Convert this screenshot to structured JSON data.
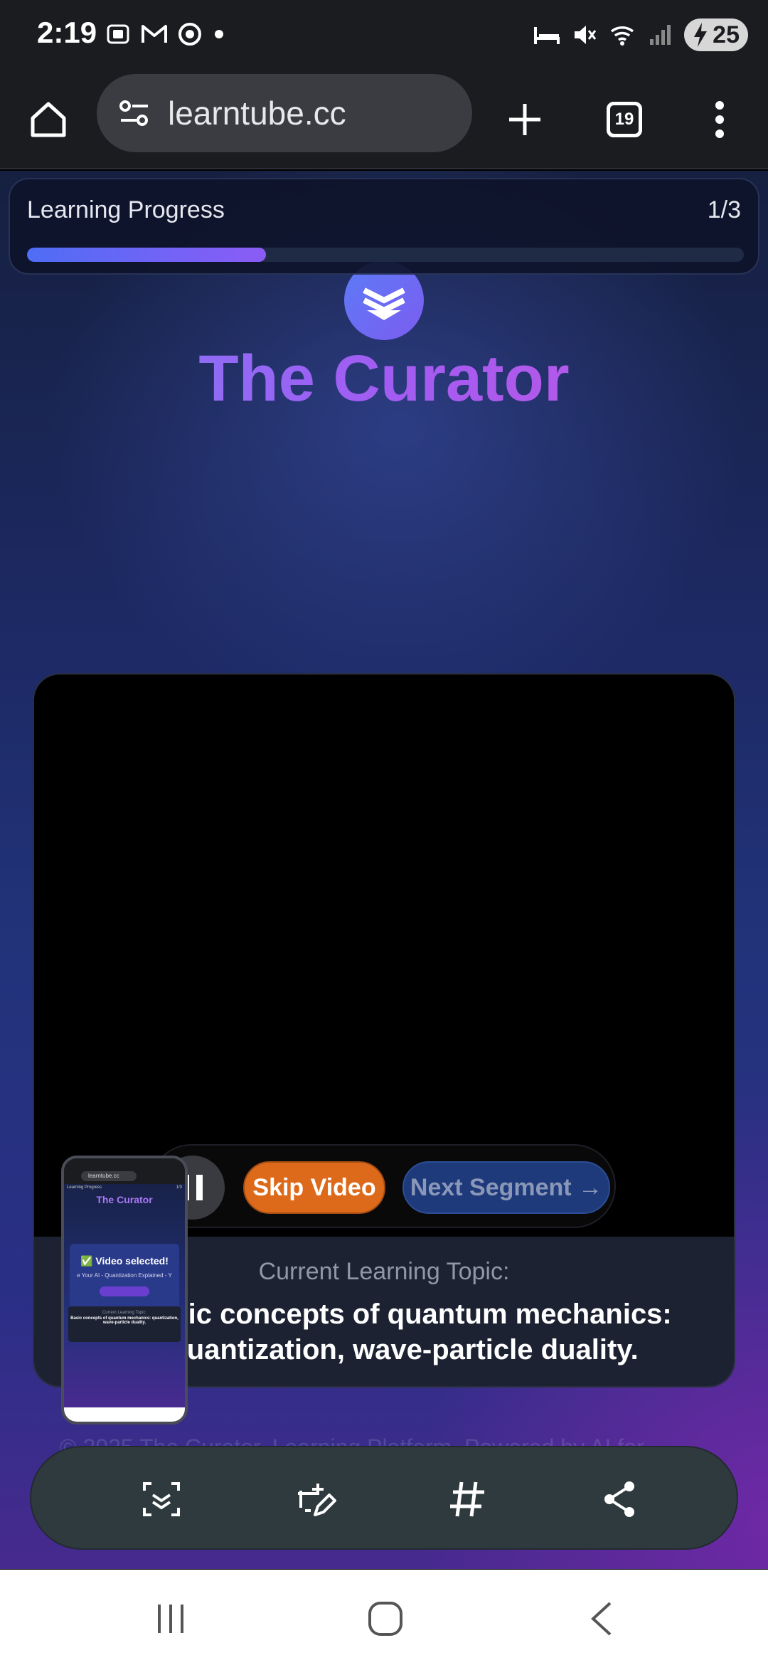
{
  "status_bar": {
    "time": "2:19",
    "battery": "25",
    "icons": [
      "screenshot-icon",
      "gmail-icon",
      "chrome-icon",
      "dot-icon",
      "sleep-icon",
      "mute-icon",
      "wifi-icon",
      "signal-icon",
      "battery-icon"
    ]
  },
  "browser": {
    "url": "learntube.cc",
    "tab_count": "19"
  },
  "progress": {
    "title": "Learning Progress",
    "count": "1/3",
    "fraction": 0.333
  },
  "brand": {
    "name": "The Curator"
  },
  "video": {
    "skip_label": "Skip Video",
    "next_label": "Next Segment →"
  },
  "topic": {
    "label": "Current Learning Topic:",
    "text": "Basic concepts of quantum mechanics: quantization, wave-particle duality."
  },
  "footer": {
    "text": "© 2025 The Curator. Learning Platform. Powered by AI for"
  },
  "thumbnail": {
    "url": "learntube.cc",
    "brand": "The Curator",
    "selected": "✅ Video selected!",
    "subtitle": "e Your AI - Quantization Explained - Y",
    "progress_label": "Learning Progress",
    "progress_count": "1/3",
    "topic_label": "Current Learning Topic:",
    "topic_text": "Basic concepts of quantum mechanics: quantization, wave-particle duality."
  },
  "colors": {
    "accent_orange": "#dd6a1a",
    "accent_blue": "#1e3a7a",
    "brand_gradient_start": "#7b7cf8",
    "brand_gradient_end": "#c355df"
  }
}
